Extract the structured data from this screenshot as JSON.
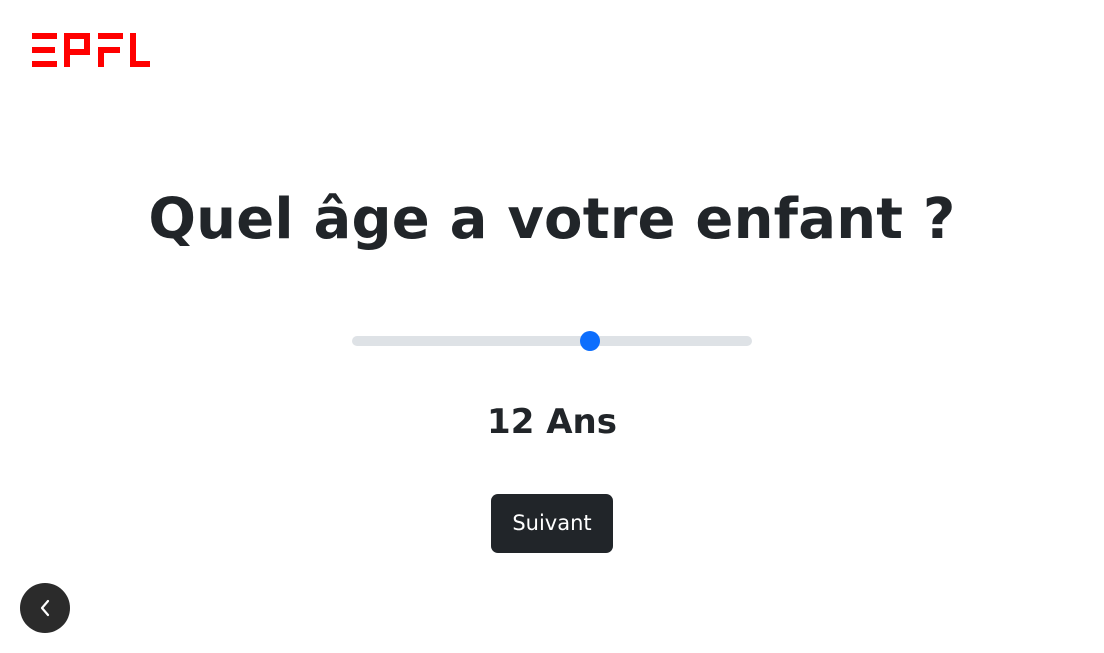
{
  "brand": {
    "logo_text": "EPFL",
    "logo_color": "#ff0000"
  },
  "question": {
    "title": "Quel âge a votre enfant ?"
  },
  "age_slider": {
    "value": 12,
    "fill_fraction": 0.595,
    "track_color": "#dee2e6",
    "thumb_color": "#0d6efd"
  },
  "age_display": {
    "value": "12",
    "unit": "Ans"
  },
  "next_button": {
    "label": "Suivant",
    "color": "#212529"
  },
  "back_button": {
    "icon": "chevron-left-icon"
  }
}
